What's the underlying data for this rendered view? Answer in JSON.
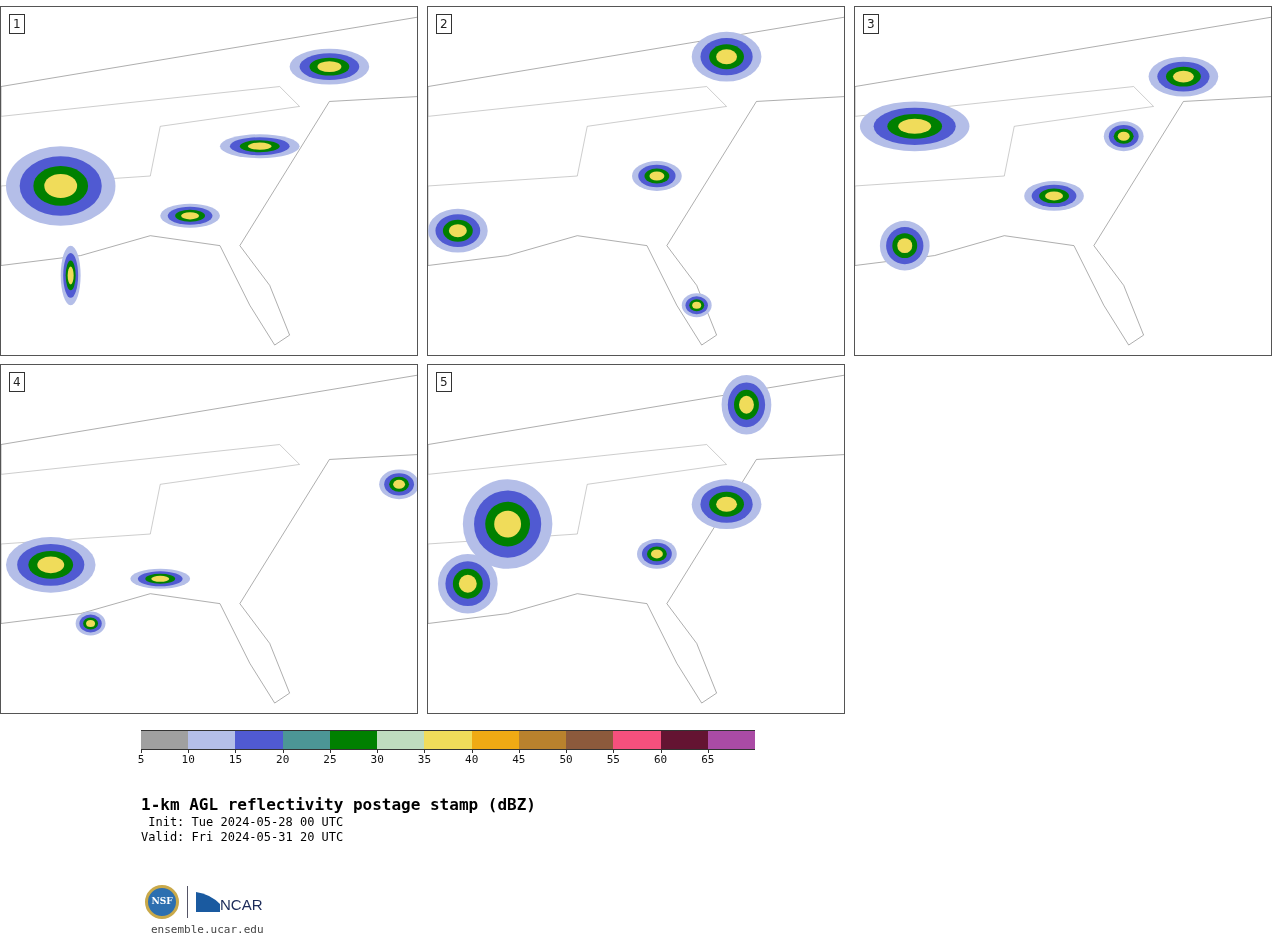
{
  "panels": [
    {
      "label": "1"
    },
    {
      "label": "2"
    },
    {
      "label": "3"
    },
    {
      "label": "4"
    },
    {
      "label": "5"
    }
  ],
  "colorbar": {
    "segments": [
      {
        "color": "#a0a0a0",
        "tick": "5"
      },
      {
        "color": "#b4bee8",
        "tick": "10"
      },
      {
        "color": "#505ad2",
        "tick": "15"
      },
      {
        "color": "#4c9696",
        "tick": "20"
      },
      {
        "color": "#008000",
        "tick": "25"
      },
      {
        "color": "#bedcbe",
        "tick": "30"
      },
      {
        "color": "#f0dc5a",
        "tick": "35"
      },
      {
        "color": "#f0aa14",
        "tick": "40"
      },
      {
        "color": "#b9822d",
        "tick": "45"
      },
      {
        "color": "#8c5a3c",
        "tick": "50"
      },
      {
        "color": "#f5507d",
        "tick": "55"
      },
      {
        "color": "#641432",
        "tick": "60"
      },
      {
        "color": "#aa4ba5",
        "tick": "65"
      }
    ]
  },
  "title": "1-km AGL reflectivity postage stamp (dBZ)",
  "init": " Init: Tue 2024-05-28 00 UTC",
  "valid": "Valid: Fri 2024-05-31 20 UTC",
  "logo": {
    "nsf": "NSF",
    "ncar": "NCAR"
  },
  "url": "ensemble.ucar.edu"
}
